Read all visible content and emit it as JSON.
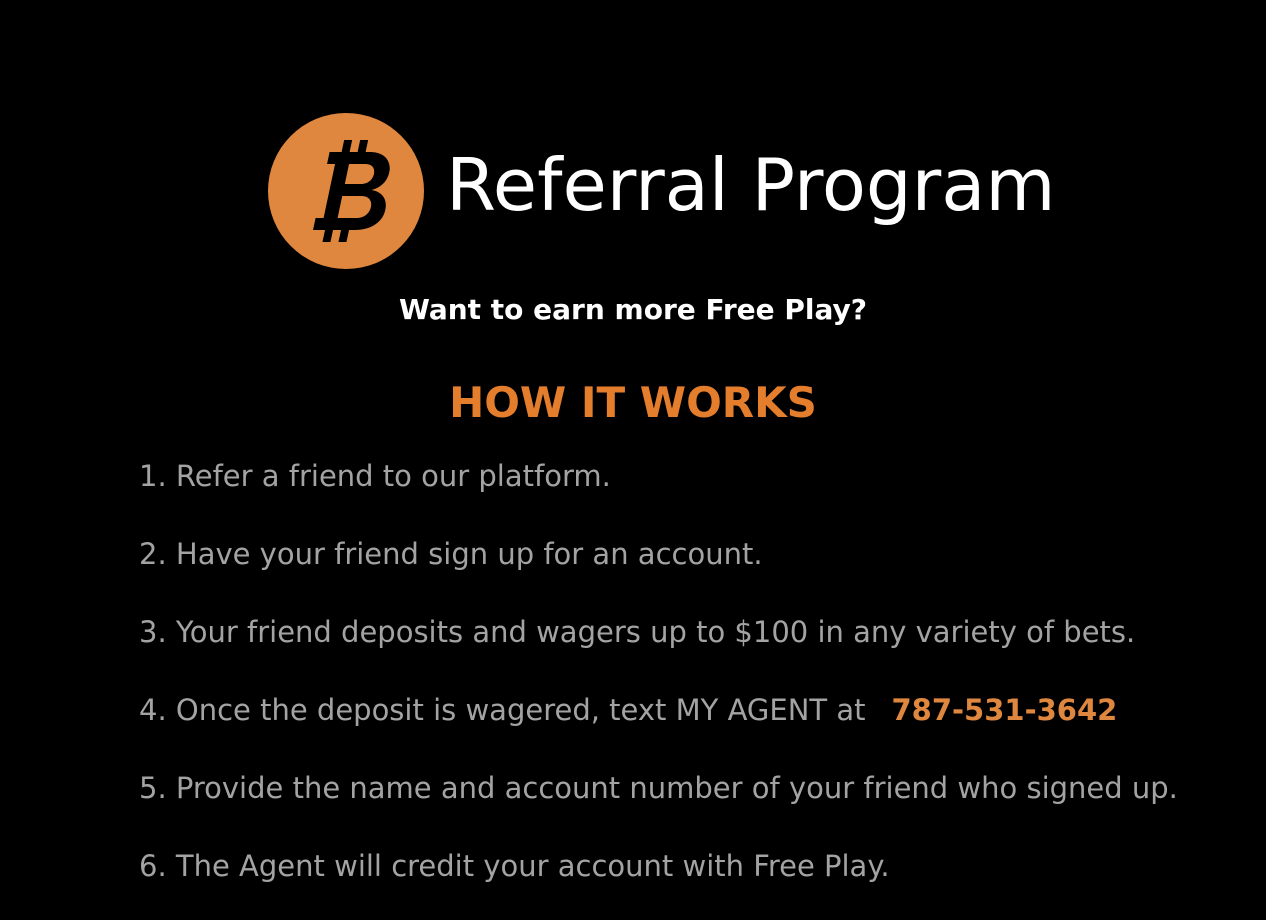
{
  "colors": {
    "background": "#000000",
    "accent": "#e0873f",
    "heading": "#e47e2c",
    "step_text": "#a3a3a3",
    "title_text": "#ffffff"
  },
  "header": {
    "logo_icon": "bitcoin-icon",
    "title": "Referral Program"
  },
  "subtitle": "Want to earn more Free Play?",
  "section_heading": "HOW IT WORKS",
  "steps": [
    {
      "text": "1. Refer a friend to our platform."
    },
    {
      "text": "2. Have your friend sign up for an account."
    },
    {
      "text": "3. Your friend deposits and wagers up to $100 in any variety of bets."
    },
    {
      "text": "4. Once the deposit is wagered, text MY AGENT at",
      "phone": "787-531-3642"
    },
    {
      "text": "5. Provide the name and account number of your friend who signed up."
    },
    {
      "text": "6. The Agent will credit your account with Free Play."
    }
  ]
}
